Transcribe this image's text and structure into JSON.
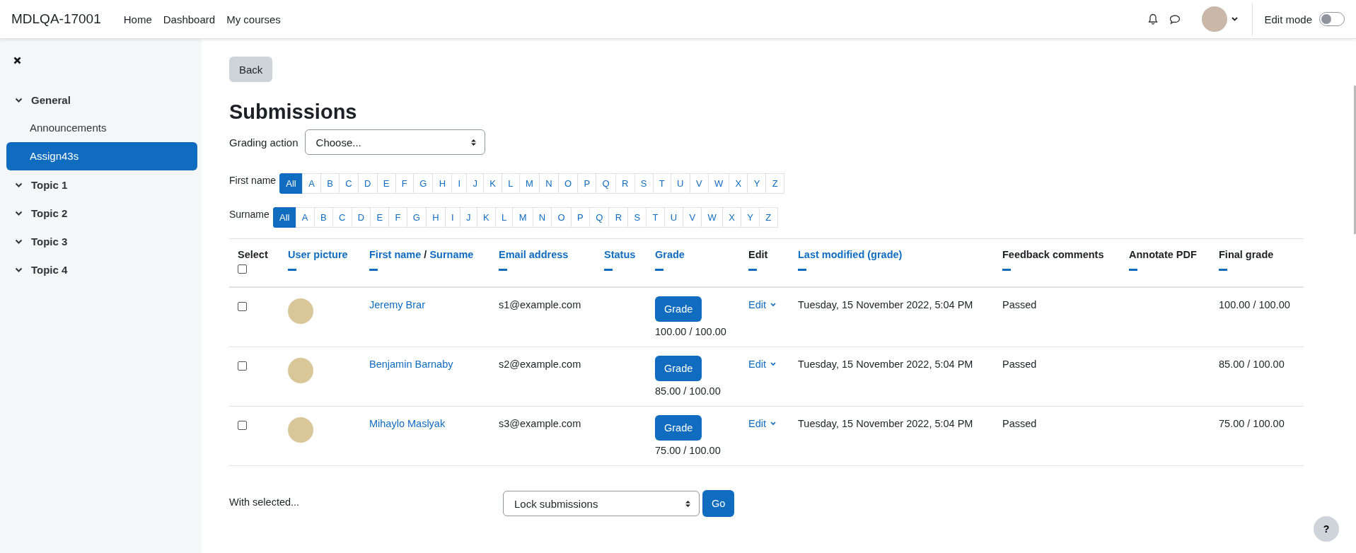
{
  "navbar": {
    "site_name": "MDLQA-17001",
    "links": [
      "Home",
      "Dashboard",
      "My courses"
    ],
    "edit_mode": {
      "label": "Edit mode",
      "on": false
    }
  },
  "sidebar": {
    "sections": [
      {
        "label": "General",
        "expanded": true,
        "children": [
          {
            "label": "Announcements",
            "selected": false
          },
          {
            "label": "Assign43s",
            "selected": true
          }
        ]
      },
      {
        "label": "Topic 1",
        "expanded": true
      },
      {
        "label": "Topic 2",
        "expanded": true
      },
      {
        "label": "Topic 3",
        "expanded": true
      },
      {
        "label": "Topic 4",
        "expanded": true
      }
    ]
  },
  "back_button": "Back",
  "title": "Submissions",
  "grading_action": {
    "label": "Grading action",
    "value": "Choose..."
  },
  "filters": [
    {
      "label": "First name",
      "letters": [
        {
          "text": "All",
          "selected": true
        },
        {
          "text": "A",
          "selected": false
        },
        {
          "text": "B",
          "selected": false
        },
        {
          "text": "C",
          "selected": false
        },
        {
          "text": "D",
          "selected": false
        },
        {
          "text": "E",
          "selected": false
        },
        {
          "text": "F",
          "selected": false
        },
        {
          "text": "G",
          "selected": false
        },
        {
          "text": "H",
          "selected": false
        },
        {
          "text": "I",
          "selected": false
        },
        {
          "text": "J",
          "selected": false
        },
        {
          "text": "K",
          "selected": false
        },
        {
          "text": "L",
          "selected": false
        },
        {
          "text": "M",
          "selected": false
        },
        {
          "text": "N",
          "selected": false
        },
        {
          "text": "O",
          "selected": false
        },
        {
          "text": "P",
          "selected": false
        },
        {
          "text": "Q",
          "selected": false
        },
        {
          "text": "R",
          "selected": false
        },
        {
          "text": "S",
          "selected": false
        },
        {
          "text": "T",
          "selected": false
        },
        {
          "text": "U",
          "selected": false
        },
        {
          "text": "V",
          "selected": false
        },
        {
          "text": "W",
          "selected": false
        },
        {
          "text": "X",
          "selected": false
        },
        {
          "text": "Y",
          "selected": false
        },
        {
          "text": "Z",
          "selected": false
        }
      ]
    },
    {
      "label": "Surname",
      "letters": [
        {
          "text": "All",
          "selected": true
        },
        {
          "text": "A",
          "selected": false
        },
        {
          "text": "B",
          "selected": false
        },
        {
          "text": "C",
          "selected": false
        },
        {
          "text": "D",
          "selected": false
        },
        {
          "text": "E",
          "selected": false
        },
        {
          "text": "F",
          "selected": false
        },
        {
          "text": "G",
          "selected": false
        },
        {
          "text": "H",
          "selected": false
        },
        {
          "text": "I",
          "selected": false
        },
        {
          "text": "J",
          "selected": false
        },
        {
          "text": "K",
          "selected": false
        },
        {
          "text": "L",
          "selected": false
        },
        {
          "text": "M",
          "selected": false
        },
        {
          "text": "N",
          "selected": false
        },
        {
          "text": "O",
          "selected": false
        },
        {
          "text": "P",
          "selected": false
        },
        {
          "text": "Q",
          "selected": false
        },
        {
          "text": "R",
          "selected": false
        },
        {
          "text": "S",
          "selected": false
        },
        {
          "text": "T",
          "selected": false
        },
        {
          "text": "U",
          "selected": false
        },
        {
          "text": "V",
          "selected": false
        },
        {
          "text": "W",
          "selected": false
        },
        {
          "text": "X",
          "selected": false
        },
        {
          "text": "Y",
          "selected": false
        },
        {
          "text": "Z",
          "selected": false
        }
      ]
    }
  ],
  "table": {
    "columns": [
      {
        "parts": [
          {
            "text": "Select",
            "kind": "plain"
          }
        ]
      },
      {
        "parts": [
          {
            "text": "User picture",
            "kind": "link"
          }
        ]
      },
      {
        "parts": [
          {
            "text": "First name",
            "kind": "link"
          },
          {
            "text": "/",
            "kind": "plain"
          },
          {
            "text": "Surname",
            "kind": "link"
          }
        ]
      },
      {
        "parts": [
          {
            "text": "Email address",
            "kind": "link"
          }
        ]
      },
      {
        "parts": [
          {
            "text": "Status",
            "kind": "link"
          }
        ]
      },
      {
        "parts": [
          {
            "text": "Grade",
            "kind": "link"
          }
        ]
      },
      {
        "parts": [
          {
            "text": "Edit",
            "kind": "plain"
          }
        ]
      },
      {
        "parts": [
          {
            "text": "Last modified (grade)",
            "kind": "link"
          }
        ]
      },
      {
        "parts": [
          {
            "text": "Feedback comments",
            "kind": "plain"
          }
        ]
      },
      {
        "parts": [
          {
            "text": "Annotate PDF",
            "kind": "plain"
          }
        ]
      },
      {
        "parts": [
          {
            "text": "Final grade",
            "kind": "plain"
          }
        ]
      }
    ],
    "select_all_checked": false,
    "rows": [
      {
        "checked": false,
        "name": "Jeremy Brar",
        "email": "s1@example.com",
        "grade_button": "Grade",
        "grade": "100.00 / 100.00",
        "edit": "Edit",
        "last_modified": "Tuesday, 15 November 2022, 5:04 PM",
        "feedback": "Passed",
        "final_grade": "100.00 / 100.00"
      },
      {
        "checked": false,
        "name": "Benjamin Barnaby",
        "email": "s2@example.com",
        "grade_button": "Grade",
        "grade": "85.00 / 100.00",
        "edit": "Edit",
        "last_modified": "Tuesday, 15 November 2022, 5:04 PM",
        "feedback": "Passed",
        "final_grade": "85.00 / 100.00"
      },
      {
        "checked": false,
        "name": "Mihaylo Maslyak",
        "email": "s3@example.com",
        "grade_button": "Grade",
        "grade": "75.00 / 100.00",
        "edit": "Edit",
        "last_modified": "Tuesday, 15 November 2022, 5:04 PM",
        "feedback": "Passed",
        "final_grade": "75.00 / 100.00"
      }
    ]
  },
  "bulk": {
    "label": "With selected...",
    "value": "Lock submissions",
    "button": "Go"
  },
  "help_button": "?"
}
